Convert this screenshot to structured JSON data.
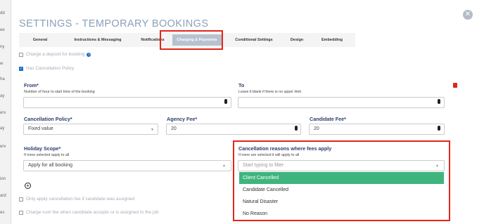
{
  "background_list": [
    "dd",
    "ee",
    "ny",
    "w",
    "ha",
    "ay",
    "erv",
    "ay",
    "erv",
    "ion",
    "ard",
    "es"
  ],
  "title": "SETTINGS - TEMPORARY BOOKINGS",
  "close_icon": "close-icon",
  "tabs": [
    {
      "label": "General"
    },
    {
      "label": "Instructions & Messaging"
    },
    {
      "label": "Notifications"
    },
    {
      "label": "Charging & Payments"
    },
    {
      "label": "Conditional Settings"
    },
    {
      "label": "Design"
    },
    {
      "label": "Embedding"
    }
  ],
  "active_tab": "Charging & Payments",
  "deposit": {
    "label": "Charge a deposit for booking",
    "checked": false,
    "icon": "info-icon",
    "info_glyph": "i"
  },
  "cancellation": {
    "label": "Has Cancellation Policy",
    "checked": true,
    "check_glyph": "✓"
  },
  "from": {
    "label": "From*",
    "help": "Number of hour to start time of the booking",
    "value": ""
  },
  "to": {
    "label": "To",
    "help": "Leave it blank if there is no upper limit",
    "value": ""
  },
  "policy": {
    "label": "Cancellation Policy*",
    "value": "Fixed value",
    "caret": "▼"
  },
  "agency_fee": {
    "label": "Agency Fee*",
    "value": "20"
  },
  "candidate_fee": {
    "label": "Candidate Fee*",
    "value": "20"
  },
  "holiday": {
    "label": "Holiday Scope*",
    "help": "If none selected apply to all",
    "value": "Apply for all booking",
    "caret": "▲"
  },
  "reasons": {
    "label": "Cancellation reasons where fees apply",
    "help": "If none are selected it will apply to all",
    "placeholder": "Start typing to filter",
    "caret": "▲",
    "options": [
      "Client Cancelled",
      "Candidate Cancelled",
      "Natural Disaster",
      "No Reason"
    ],
    "selected": "Client Cancelled"
  },
  "add_icon": "plus-icon",
  "add_glyph": "+",
  "only_apply": {
    "label": "Only apply cancellation fee if candidate was assigned",
    "checked": false
  },
  "rush_fee": {
    "label": "Charge rush fee when candidate accepts or is assigned to the job",
    "checked": false
  },
  "colors": {
    "accent": "#3fb57e",
    "highlight": "#e0261b",
    "heading": "#2c3e6b",
    "title": "#8aa0b8"
  }
}
